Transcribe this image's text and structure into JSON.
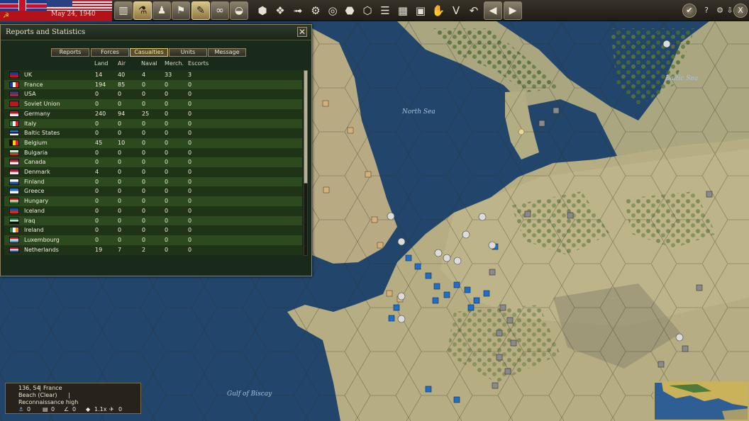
{
  "header": {
    "date": "May 24, 1940"
  },
  "toolbar": {
    "buttons": [
      {
        "name": "production-button",
        "icon": "factory-icon",
        "glyph": "▥",
        "active": false
      },
      {
        "name": "research-button",
        "icon": "research-icon",
        "glyph": "⚗",
        "active": true
      },
      {
        "name": "diplomacy-button",
        "icon": "diplomacy-icon",
        "glyph": "♟",
        "active": false
      },
      {
        "name": "objectives-button",
        "icon": "flag-icon",
        "glyph": "⚑",
        "active": false
      },
      {
        "name": "reports-button",
        "icon": "report-icon",
        "glyph": "✎",
        "active": true
      },
      {
        "name": "recon-button",
        "icon": "binoculars-icon",
        "glyph": "∞",
        "active": false
      },
      {
        "name": "units-button",
        "icon": "helmet-icon",
        "glyph": "◒",
        "active": false
      }
    ],
    "map_tools": [
      {
        "name": "hex-filter-1-button",
        "icon": "hex-icon",
        "glyph": "⬢"
      },
      {
        "name": "hex-filter-2-button",
        "icon": "hex-cluster-icon",
        "glyph": "❖"
      },
      {
        "name": "move-arrow-button",
        "icon": "arrow-hex-icon",
        "glyph": "➟"
      },
      {
        "name": "supply-button",
        "icon": "supply-icon",
        "glyph": "⚙"
      },
      {
        "name": "target-button",
        "icon": "crosshair-icon",
        "glyph": "◎"
      },
      {
        "name": "fog-button",
        "icon": "fog-icon",
        "glyph": "⬣"
      },
      {
        "name": "terrain-button",
        "icon": "terrain-icon",
        "glyph": "⬡"
      },
      {
        "name": "rail-button",
        "icon": "rail-icon",
        "glyph": "☰"
      },
      {
        "name": "grid-button",
        "icon": "grid-icon",
        "glyph": "▦"
      },
      {
        "name": "frame-button",
        "icon": "frame-icon",
        "glyph": "▣"
      },
      {
        "name": "hand-button",
        "icon": "hand-icon",
        "glyph": "✋"
      },
      {
        "name": "victory-button",
        "icon": "victory-icon",
        "glyph": "V"
      }
    ]
  },
  "panel": {
    "title": "Reports and Statistics",
    "tabs": [
      {
        "label": "Reports",
        "active": false
      },
      {
        "label": "Forces",
        "active": false
      },
      {
        "label": "Casualties",
        "active": true
      },
      {
        "label": "Units",
        "active": false
      },
      {
        "label": "Message",
        "active": false
      }
    ],
    "columns": [
      "Land",
      "Air",
      "Naval",
      "Merch.",
      "Escorts"
    ],
    "rows": [
      {
        "country": "UK",
        "flag": "uk",
        "land": "14",
        "air": "40",
        "naval": "4",
        "merch": "33",
        "escorts": "3"
      },
      {
        "country": "France",
        "flag": "fr",
        "land": "194",
        "air": "85",
        "naval": "0",
        "merch": "0",
        "escorts": "0"
      },
      {
        "country": "USA",
        "flag": "us",
        "land": "0",
        "air": "0",
        "naval": "0",
        "merch": "0",
        "escorts": "0"
      },
      {
        "country": "Soviet Union",
        "flag": "su",
        "land": "0",
        "air": "0",
        "naval": "0",
        "merch": "0",
        "escorts": "0"
      },
      {
        "country": "Germany",
        "flag": "de",
        "land": "240",
        "air": "94",
        "naval": "25",
        "merch": "0",
        "escorts": "0"
      },
      {
        "country": "Italy",
        "flag": "it",
        "land": "0",
        "air": "0",
        "naval": "0",
        "merch": "0",
        "escorts": "0"
      },
      {
        "country": "Baltic States",
        "flag": "ee",
        "land": "0",
        "air": "0",
        "naval": "0",
        "merch": "0",
        "escorts": "0"
      },
      {
        "country": "Belgium",
        "flag": "be",
        "land": "45",
        "air": "10",
        "naval": "0",
        "merch": "0",
        "escorts": "0"
      },
      {
        "country": "Bulgaria",
        "flag": "bg",
        "land": "0",
        "air": "0",
        "naval": "0",
        "merch": "0",
        "escorts": "0"
      },
      {
        "country": "Canada",
        "flag": "ca",
        "land": "0",
        "air": "0",
        "naval": "0",
        "merch": "0",
        "escorts": "0"
      },
      {
        "country": "Denmark",
        "flag": "dk",
        "land": "4",
        "air": "0",
        "naval": "0",
        "merch": "0",
        "escorts": "0"
      },
      {
        "country": "Finland",
        "flag": "fi",
        "land": "0",
        "air": "0",
        "naval": "0",
        "merch": "0",
        "escorts": "0"
      },
      {
        "country": "Greece",
        "flag": "gr",
        "land": "0",
        "air": "0",
        "naval": "0",
        "merch": "0",
        "escorts": "0"
      },
      {
        "country": "Hungary",
        "flag": "hu",
        "land": "0",
        "air": "0",
        "naval": "0",
        "merch": "0",
        "escorts": "0"
      },
      {
        "country": "Iceland",
        "flag": "is",
        "land": "0",
        "air": "0",
        "naval": "0",
        "merch": "0",
        "escorts": "0"
      },
      {
        "country": "Iraq",
        "flag": "iq",
        "land": "0",
        "air": "0",
        "naval": "0",
        "merch": "0",
        "escorts": "0"
      },
      {
        "country": "Ireland",
        "flag": "ie",
        "land": "0",
        "air": "0",
        "naval": "0",
        "merch": "0",
        "escorts": "0"
      },
      {
        "country": "Luxembourg",
        "flag": "lu",
        "land": "0",
        "air": "0",
        "naval": "0",
        "merch": "0",
        "escorts": "0"
      },
      {
        "country": "Netherlands",
        "flag": "nl",
        "land": "19",
        "air": "7",
        "naval": "2",
        "merch": "0",
        "escorts": "0"
      }
    ]
  },
  "map": {
    "labels": [
      "North Sea",
      "Baltic Sea",
      "Gulf of Biscay"
    ]
  },
  "info": {
    "coords": "136, 54",
    "region": "France",
    "terrain": "Beach (Clear)",
    "recon": "Reconnaissance high",
    "stats": [
      "0",
      "0",
      "0",
      "1.1x",
      "0"
    ]
  },
  "flag_colors": {
    "uk": [
      "#203a8a",
      "#c8102e"
    ],
    "fr": [
      "#1e3a9a",
      "#f4f4f4",
      "#d52b1e"
    ],
    "us": [
      "#2b3f85",
      "#b22234"
    ],
    "su": [
      "#c0141c",
      "#c0141c"
    ],
    "de": [
      "#c0141c",
      "#f4f4f4"
    ],
    "it": [
      "#1f8a3e",
      "#f4f4f4",
      "#d52b1e"
    ],
    "ee": [
      "#2c6ec7",
      "#111111",
      "#f4f4f4"
    ],
    "be": [
      "#111111",
      "#f1d11c",
      "#d52b1e"
    ],
    "bg": [
      "#f4f4f4",
      "#1f8a3e",
      "#d52b1e"
    ],
    "ca": [
      "#c8102e",
      "#f4f4f4"
    ],
    "dk": [
      "#c8102e",
      "#f4f4f4"
    ],
    "fi": [
      "#f4f4f4",
      "#1b4fa0"
    ],
    "gr": [
      "#2f6fc2",
      "#f4f4f4"
    ],
    "hu": [
      "#d52b1e",
      "#f4f4f4",
      "#2b8a3e"
    ],
    "is": [
      "#1b4fa0",
      "#d52b1e"
    ],
    "iq": [
      "#1f8a3e",
      "#f4f4f4",
      "#111111"
    ],
    "ie": [
      "#1f8a3e",
      "#f4f4f4",
      "#f28a1c"
    ],
    "lu": [
      "#d52b1e",
      "#f4f4f4",
      "#3aa0db"
    ],
    "nl": [
      "#c8102e",
      "#f4f4f4",
      "#1b4fa0"
    ]
  }
}
